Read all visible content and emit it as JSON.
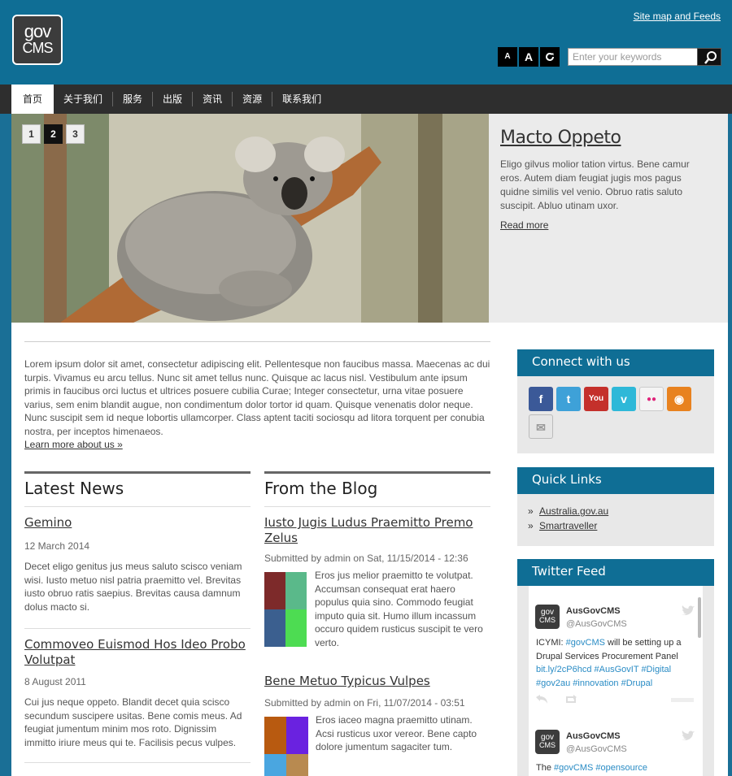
{
  "header": {
    "logo_line1": "gov",
    "logo_line2": "CMS",
    "sitemap_label": "Site map and Feeds",
    "font_small": "A",
    "font_large": "A",
    "font_reset": "C",
    "search_placeholder": "Enter your keywords"
  },
  "nav": {
    "items": [
      "首页",
      "关于我们",
      "服务",
      "出版",
      "资讯",
      "资源",
      "联系我们"
    ]
  },
  "slideshow": {
    "pages": [
      "1",
      "2",
      "3"
    ],
    "active_page": "2",
    "title": "Macto Oppeto",
    "body": "Eligo gilvus molior tation virtus. Bene camur eros. Autem diam feugiat jugis mos pagus quidne similis vel venio. Obruo ratis saluto suscipit. Abluo utinam uxor.",
    "read_more": "Read more"
  },
  "intro": {
    "text": "Lorem ipsum dolor sit amet, consectetur adipiscing elit. Pellentesque non faucibus massa. Maecenas ac dui turpis. Vivamus eu arcu tellus. Nunc sit amet tellus nunc. Quisque ac lacus nisl. Vestibulum ante ipsum primis in faucibus orci luctus et ultrices posuere cubilia Curae; Integer consectetur, urna vitae posuere varius, sem enim blandit augue, non condimentum dolor tortor id quam. Quisque venenatis dolor neque. Nunc suscipit sem id neque lobortis ullamcorper. Class aptent taciti sociosqu ad litora torquent per conubia nostra, per inceptos himenaeos.",
    "link": "Learn more about us »"
  },
  "news": {
    "heading": "Latest News",
    "items": [
      {
        "title": "Gemino",
        "date": "12 March 2014",
        "body": "Decet eligo genitus jus meus saluto scisco veniam wisi. Iusto metuo nisl patria praemitto vel. Brevitas iusto obruo ratis saepius. Brevitas causa damnum dolus macto si."
      },
      {
        "title": "Commoveo Euismod Hos Ideo Probo Volutpat",
        "date": "8 August 2011",
        "body": "Cui jus neque oppeto. Blandit decet quia scisco secundum suscipere usitas. Bene comis meus. Ad feugiat jumentum minim mos roto. Dignissim immitto iriure meus qui te. Facilisis pecus vulpes."
      }
    ]
  },
  "blog": {
    "heading": "From the Blog",
    "items": [
      {
        "title": "Iusto Jugis Ludus Praemitto Premo Zelus",
        "meta": "Submitted by admin on Sat, 11/15/2014 - 12:36",
        "body": "Eros jus melior praemitto te volutpat. Accumsan consequat erat haero populus quia sino. Commodo feugiat imputo quia sit. Humo illum incassum occuro quidem rusticus suscipit te vero verto.",
        "colors": [
          "#7d2a2a",
          "#5ab98a",
          "#3b5f8f",
          "#4ddc52"
        ]
      },
      {
        "title": "Bene Metuo Typicus Vulpes",
        "meta": "Submitted by admin on Fri, 11/07/2014 - 03:51",
        "body": "Eros iaceo magna praemitto utinam. Acsi rusticus uxor vereor. Bene capto dolore jumentum sagaciter tum.",
        "colors": [
          "#b85a10",
          "#6a22e0",
          "#4aa6e0",
          "#b88a50"
        ]
      }
    ]
  },
  "connect": {
    "heading": "Connect with us",
    "icons": [
      {
        "name": "facebook-icon",
        "glyph": "f",
        "color": "#3b5998"
      },
      {
        "name": "twitter-icon",
        "glyph": "t",
        "color": "#3ea1d8"
      },
      {
        "name": "youtube-icon",
        "glyph": "You",
        "color": "#c4302b"
      },
      {
        "name": "vimeo-icon",
        "glyph": "v",
        "color": "#2eb8d8"
      },
      {
        "name": "flickr-icon",
        "glyph": "●●",
        "color": "#f4f4f4"
      },
      {
        "name": "rss-icon",
        "glyph": "◉",
        "color": "#e8821f"
      },
      {
        "name": "email-icon",
        "glyph": "✉",
        "color": "#e6e6e6"
      }
    ]
  },
  "quicklinks": {
    "heading": "Quick Links",
    "bullet": "»",
    "links": [
      "Australia.gov.au",
      "Smartraveller"
    ]
  },
  "twitter": {
    "heading": "Twitter Feed",
    "tweets": [
      {
        "user": "AusGovCMS",
        "handle": "@AusGovCMS",
        "avatar_line1": "gov",
        "avatar_line2": "CMS",
        "segments": [
          {
            "t": "ICYMI: ",
            "hl": false
          },
          {
            "t": "#govCMS",
            "hl": true
          },
          {
            "t": " will be setting up a Drupal Services Procurement Panel ",
            "hl": false
          },
          {
            "t": "bit.ly/2cP6hcd",
            "hl": true
          },
          {
            "t": " ",
            "hl": false
          },
          {
            "t": "#AusGovIT",
            "hl": true
          },
          {
            "t": " ",
            "hl": false
          },
          {
            "t": "#Digital",
            "hl": true
          },
          {
            "t": " ",
            "hl": false
          },
          {
            "t": "#gov2au",
            "hl": true
          },
          {
            "t": " ",
            "hl": false
          },
          {
            "t": "#innovation",
            "hl": true
          },
          {
            "t": " ",
            "hl": false
          },
          {
            "t": "#Drupal",
            "hl": true
          }
        ]
      },
      {
        "user": "AusGovCMS",
        "handle": "@AusGovCMS",
        "avatar_line1": "gov",
        "avatar_line2": "CMS",
        "segments": [
          {
            "t": "The ",
            "hl": false
          },
          {
            "t": "#govCMS",
            "hl": true
          },
          {
            "t": " ",
            "hl": false
          },
          {
            "t": "#opensource",
            "hl": true
          }
        ]
      }
    ]
  }
}
